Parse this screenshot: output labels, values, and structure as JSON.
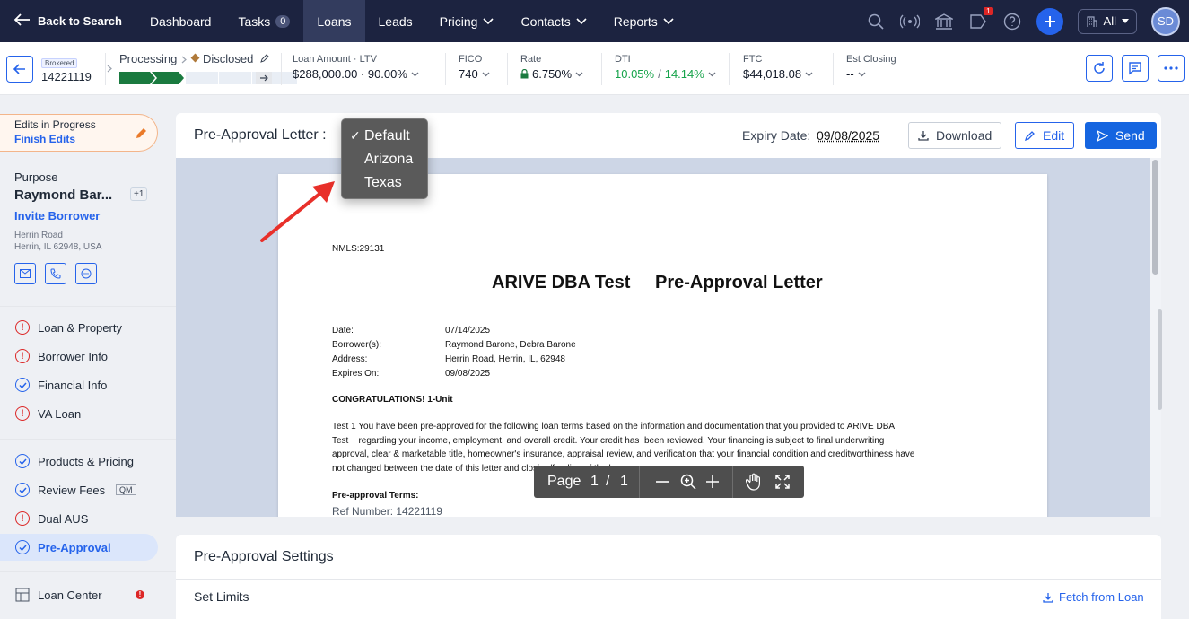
{
  "topnav": {
    "back_label": "Back to Search",
    "items": [
      {
        "label": "Dashboard"
      },
      {
        "label": "Tasks",
        "count": "0"
      },
      {
        "label": "Loans"
      },
      {
        "label": "Leads"
      },
      {
        "label": "Pricing"
      },
      {
        "label": "Contacts"
      },
      {
        "label": "Reports"
      }
    ],
    "notification_count": "1",
    "company_filter": "All",
    "avatar_initials": "SD"
  },
  "loanbar": {
    "channel_badge": "Brokered",
    "loan_number": "14221119",
    "stage": "Processing",
    "status": "Disclosed",
    "loan_amount_label": "Loan Amount · LTV",
    "loan_amount_value": "$288,000.00 · 90.00%",
    "fico_label": "FICO",
    "fico_value": "740",
    "rate_label": "Rate",
    "rate_value": "6.750%",
    "dti_label": "DTI",
    "dti_front": "10.05%",
    "dti_sep": "/",
    "dti_back": "14.14%",
    "ftc_label": "FTC",
    "ftc_value": "$44,018.08",
    "est_closing_label": "Est Closing",
    "est_closing_value": "--"
  },
  "sidebar": {
    "edits_title": "Edits in Progress",
    "finish_edits": "Finish Edits",
    "loan_purpose": "Purpose",
    "borrower_name": "Raymond Bar...",
    "coborrower_count": "+1",
    "invite_borrower": "Invite Borrower",
    "address_line1": "Herrin Road",
    "address_line2": "Herrin, IL 62948, USA",
    "nav_group1": [
      {
        "label": "Loan & Property",
        "status": "warning"
      },
      {
        "label": "Borrower Info",
        "status": "warning"
      },
      {
        "label": "Financial Info",
        "status": "complete"
      },
      {
        "label": "VA Loan",
        "status": "warning"
      }
    ],
    "nav_group2": [
      {
        "label": "Products & Pricing",
        "status": "complete"
      },
      {
        "label": "Review Fees",
        "status": "complete",
        "tag": "QM"
      },
      {
        "label": "Dual AUS",
        "status": "warning"
      },
      {
        "label": "Pre-Approval",
        "status": "complete"
      }
    ],
    "loan_center": "Loan Center"
  },
  "letter_card": {
    "title": "Pre-Approval Letter :",
    "expiry_label": "Expiry Date:",
    "expiry_value": "09/08/2025",
    "download": "Download",
    "edit": "Edit",
    "send": "Send"
  },
  "template_dropdown": {
    "selected": "Default",
    "options": [
      "Default",
      "Arizona",
      "Texas"
    ]
  },
  "document": {
    "nmls": "NMLS:29131",
    "heading_company": "ARIVE DBA Test",
    "heading_title": "Pre-Approval Letter",
    "fields": [
      {
        "label": "Date:",
        "value": "07/14/2025"
      },
      {
        "label": "Borrower(s):",
        "value": "Raymond Barone, Debra Barone"
      },
      {
        "label": "Address:",
        "value": "Herrin Road, Herrin, IL, 62948"
      },
      {
        "label": "Expires On:",
        "value": "09/08/2025"
      }
    ],
    "congrats": "CONGRATULATIONS! 1-Unit",
    "body_lines": [
      "Test 1 You have been pre-approved for the following loan terms based on the information and  documentation that you provided to ARIVE DBA",
      "Test    regarding your income, employment, and overall credit. Your credit has  been reviewed. Your financing is subject to final underwriting",
      "approval, clear & marketable title, homeowner's  insurance, appraisal review, and verification that your financial condition and creditworthiness have",
      "not changed  between the date of this letter and closing/funding of the loan.c"
    ],
    "terms_heading": "Pre-approval Terms:",
    "ref_number": "Ref Number: 14221119"
  },
  "pdf_toolbar": {
    "page_label": "Page",
    "current_page": "1",
    "separator": "/",
    "total_pages": "1"
  },
  "settings": {
    "title": "Pre-Approval Settings",
    "set_limits": "Set Limits",
    "fetch_from_loan": "Fetch from Loan"
  },
  "colors": {
    "nav_bg": "#1c2340",
    "primary": "#1565e0",
    "progress_green": "#1a7a3f",
    "warning_red": "#dc2626",
    "dti_green": "#16a34a"
  }
}
